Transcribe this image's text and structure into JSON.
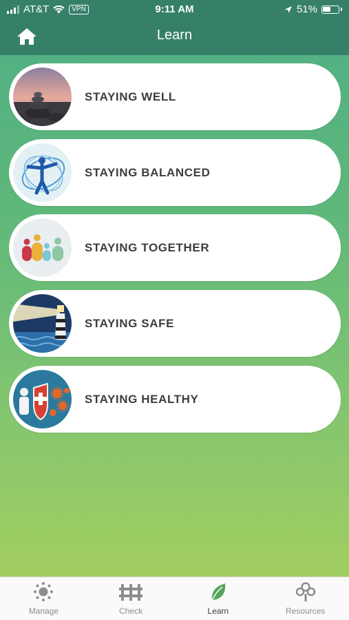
{
  "status": {
    "carrier": "AT&T",
    "vpn": "VPN",
    "time": "9:11 AM",
    "battery": "51%"
  },
  "header": {
    "title": "Learn",
    "home_icon": "home-icon"
  },
  "cards": [
    {
      "label": "STAYING WELL",
      "icon": "stones-icon"
    },
    {
      "label": "STAYING BALANCED",
      "icon": "vitruvian-icon"
    },
    {
      "label": "STAYING TOGETHER",
      "icon": "family-icon"
    },
    {
      "label": "STAYING SAFE",
      "icon": "lighthouse-icon"
    },
    {
      "label": "STAYING HEALTHY",
      "icon": "shield-virus-icon"
    }
  ],
  "tabs": [
    {
      "label": "Manage",
      "icon": "sun-icon",
      "active": false
    },
    {
      "label": "Check",
      "icon": "fence-icon",
      "active": false
    },
    {
      "label": "Learn",
      "icon": "leaf-icon",
      "active": true
    },
    {
      "label": "Resources",
      "icon": "tree-icon",
      "active": false
    }
  ],
  "colors": {
    "header": "#36806a",
    "accent_green": "#57a55a",
    "card_text": "#3d3d3d"
  }
}
